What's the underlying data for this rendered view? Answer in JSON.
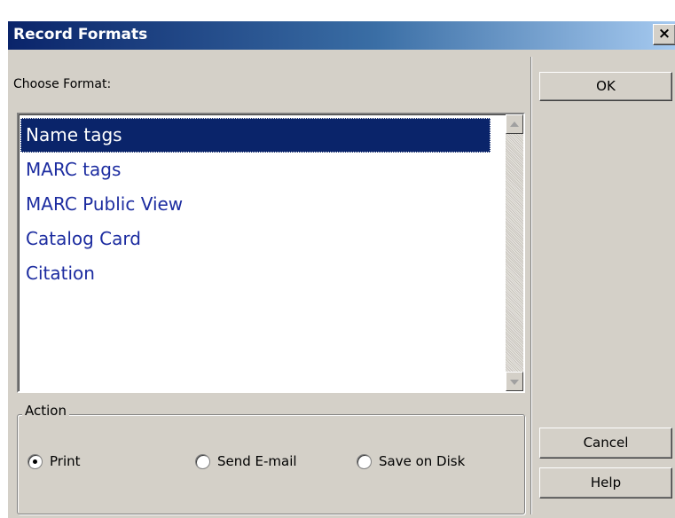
{
  "window": {
    "title": "Record Formats",
    "close_label": "×"
  },
  "format_section": {
    "label": "Choose Format:",
    "options": [
      "Name tags",
      "MARC tags",
      "MARC Public View",
      "Catalog Card",
      "Citation"
    ],
    "selected": "Name tags"
  },
  "action": {
    "legend": "Action",
    "options": [
      {
        "label": "Print",
        "checked": true
      },
      {
        "label": "Send E-mail",
        "checked": false
      },
      {
        "label": "Save on Disk",
        "checked": false
      }
    ]
  },
  "buttons": {
    "ok": "OK",
    "cancel": "Cancel",
    "help": "Help"
  },
  "colors": {
    "selection": "#0a246a",
    "item_text": "#1c2ca0",
    "dialog_bg": "#d4d0c8"
  }
}
